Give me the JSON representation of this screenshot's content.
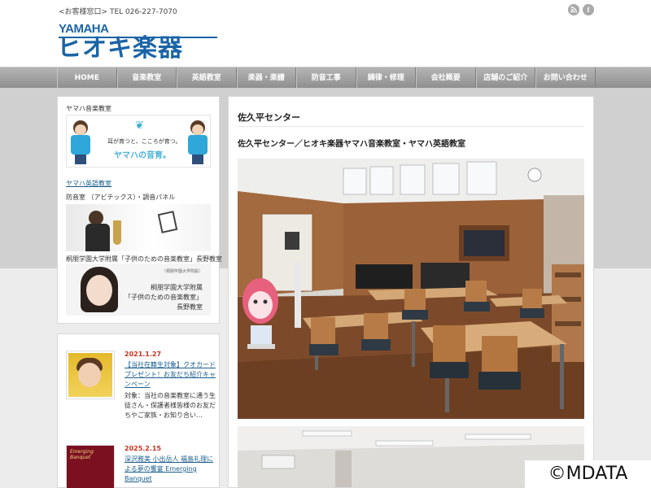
{
  "header": {
    "contact": "<お客様窓口> TEL 026-227-7070",
    "logo_sub": "YAMAHA",
    "logo_main": "ヒオキ楽器",
    "social_rss": "rss-icon",
    "social_fb": "f"
  },
  "nav": {
    "items": [
      "HOME",
      "音楽教室",
      "英語教室",
      "楽器・楽譜",
      "防音工事",
      "調律・修理",
      "会社概要",
      "店舗のご紹介",
      "お問い合わせ"
    ]
  },
  "sidebar": {
    "music_school_title": "ヤマハ音楽教室",
    "banner1_text": "耳が育つと、こころが育つ。",
    "banner1_sub": "ヤマハの音育。",
    "english_link": "ヤマハ英語教室",
    "soundproof_title": "防音室 （アビテックス）・調音パネル",
    "toho_title": "桐朋学園大学附属「子供のための音楽教室」長野教室",
    "banner3_small": "〔桐朋学園大学附属〕",
    "banner3_line1": "桐朋学園大学附属",
    "banner3_line2": "「子供のための音楽教室」",
    "banner3_line3": "長野教室"
  },
  "news": [
    {
      "date": "2021.1.27",
      "title": "【当社在籍生対象】クオカードプレゼント！お友だち紹介キャンペーン",
      "excerpt": "対象：当社の音楽教室に通う生徒さん・保護者様皆様のお友だちやご家族・お知り合い..."
    },
    {
      "date": "2025.2.15",
      "title": "深沢雅美 小出岳人 福島礼理による夢の饗宴 Emerging Banquet",
      "thumb_text": "Emerging Banquet"
    }
  ],
  "main": {
    "title": "佐久平センター",
    "subtitle": "佐久平センター／ヒオキ楽器ヤマハ音楽教室・ヤマハ英語教室"
  },
  "watermark": "©MDATA"
}
